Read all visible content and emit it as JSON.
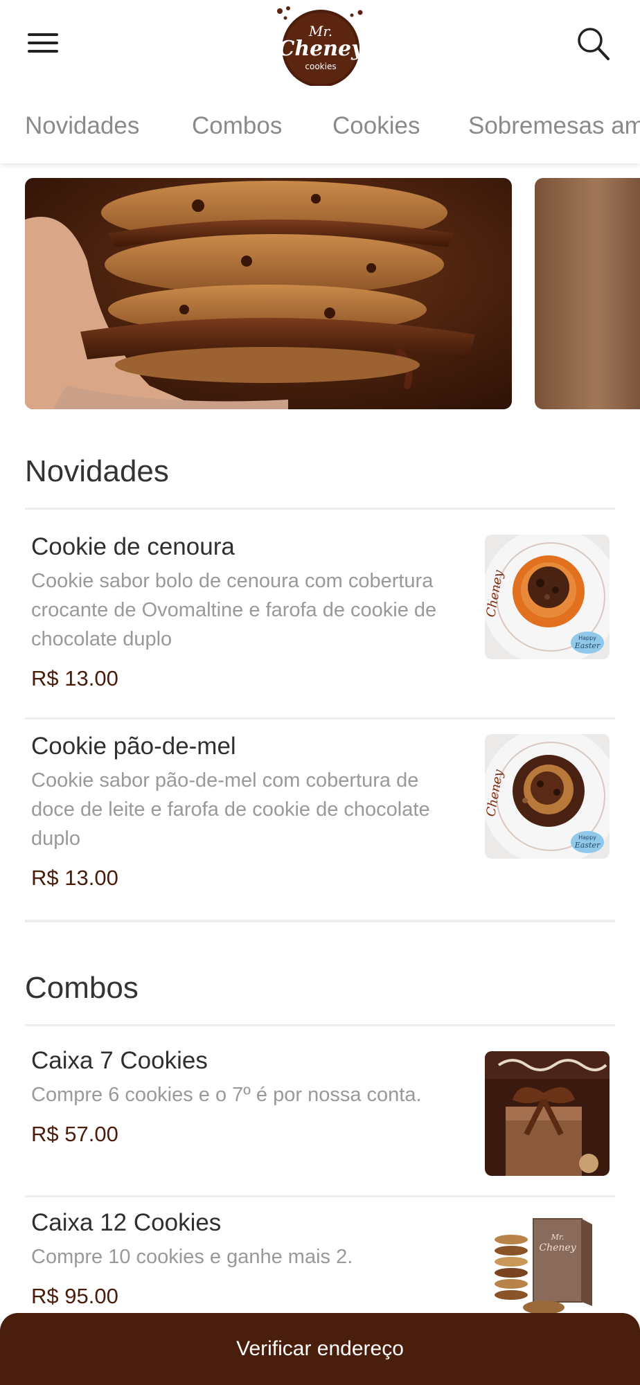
{
  "header": {
    "logo_lines": [
      "Mr.",
      "Cheney",
      "cookies"
    ]
  },
  "categories": [
    {
      "label": "Novidades"
    },
    {
      "label": "Combos"
    },
    {
      "label": "Cookies"
    },
    {
      "label": "Sobremesas am"
    }
  ],
  "sections": [
    {
      "title": "Novidades",
      "items": [
        {
          "name": "Cookie de cenoura",
          "description_lines": [
            "Cookie sabor bolo de cenoura com cobertura",
            "crocante de Ovomaltine e farofa de cookie de",
            "chocolate duplo"
          ],
          "price": "R$ 13.00",
          "image_badge": [
            "Happy",
            "Easter"
          ]
        },
        {
          "name": "Cookie pão-de-mel",
          "description_lines": [
            "Cookie sabor pão-de-mel com cobertura de",
            "doce de leite e farofa de cookie de chocolate",
            "duplo"
          ],
          "price": "R$ 13.00",
          "image_badge": [
            "Happy",
            "Easter"
          ]
        }
      ]
    },
    {
      "title": "Combos",
      "items": [
        {
          "name": "Caixa 7 Cookies",
          "description_lines": [
            "Compre 6 cookies e o 7º é por nossa conta."
          ],
          "price": "R$ 57.00"
        },
        {
          "name": "Caixa 12 Cookies",
          "description_lines": [
            "Compre 10 cookies e ganhe mais 2."
          ],
          "price": "R$ 95.00",
          "image_label": [
            "Mr.",
            "Cheney"
          ]
        }
      ]
    }
  ],
  "bottom_button": {
    "label": "Verificar endereço"
  },
  "colors": {
    "brand_brown": "#4a1e0c",
    "price": "#4a1c0a",
    "muted": "#999999"
  }
}
